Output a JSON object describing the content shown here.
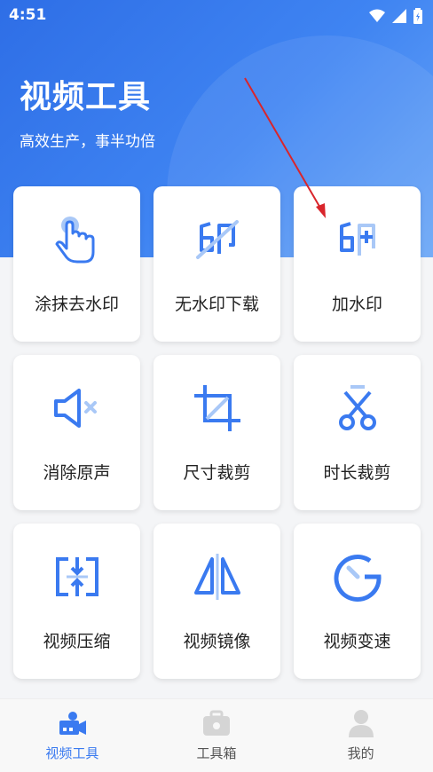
{
  "status_bar": {
    "time": "4:51"
  },
  "header": {
    "title": "视频工具",
    "subtitle": "高效生产，事半功倍"
  },
  "tools": [
    {
      "label": "涂抹去水印",
      "icon": "tap-hand-icon"
    },
    {
      "label": "无水印下载",
      "icon": "no-watermark-icon"
    },
    {
      "label": "加水印",
      "icon": "add-watermark-icon"
    },
    {
      "label": "消除原声",
      "icon": "mute-speaker-icon"
    },
    {
      "label": "尺寸裁剪",
      "icon": "crop-icon"
    },
    {
      "label": "时长裁剪",
      "icon": "scissors-icon"
    },
    {
      "label": "视频压缩",
      "icon": "compress-icon"
    },
    {
      "label": "视频镜像",
      "icon": "mirror-icon"
    },
    {
      "label": "视频变速",
      "icon": "speed-gauge-icon"
    }
  ],
  "bottom_nav": [
    {
      "label": "视频工具",
      "active": true
    },
    {
      "label": "工具箱",
      "active": false
    },
    {
      "label": "我的",
      "active": false
    }
  ],
  "colors": {
    "accent": "#3a7af0",
    "icon_light": "#a9c8f7",
    "annotation_arrow": "#d9252b"
  }
}
